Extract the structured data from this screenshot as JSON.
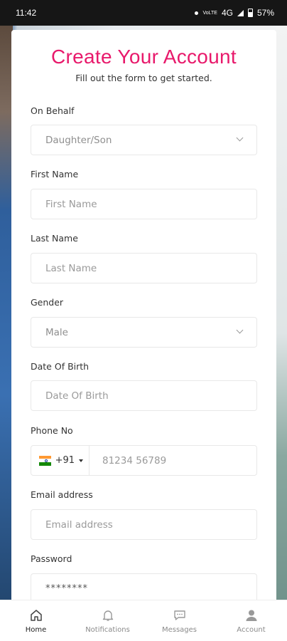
{
  "status_bar": {
    "time": "11:42",
    "volte_top": "VoLTE",
    "network": "4G",
    "battery": "57%"
  },
  "form": {
    "title": "Create Your Account",
    "subtitle": "Fill out the form to get started.",
    "on_behalf": {
      "label": "On Behalf",
      "value": "Daughter/Son"
    },
    "first_name": {
      "label": "First Name",
      "placeholder": "First Name"
    },
    "last_name": {
      "label": "Last Name",
      "placeholder": "Last Name"
    },
    "gender": {
      "label": "Gender",
      "value": "Male"
    },
    "dob": {
      "label": "Date Of Birth",
      "placeholder": "Date Of Birth"
    },
    "phone": {
      "label": "Phone No",
      "country_code": "+91",
      "placeholder": "81234 56789"
    },
    "email": {
      "label": "Email address",
      "placeholder": "Email address"
    },
    "password": {
      "label": "Password",
      "value": "********"
    }
  },
  "bottom_nav": {
    "home": "Home",
    "notifications": "Notifications",
    "messages": "Messages",
    "account": "Account"
  },
  "colors": {
    "accent": "#e8196b",
    "status_bar": "#161616"
  }
}
